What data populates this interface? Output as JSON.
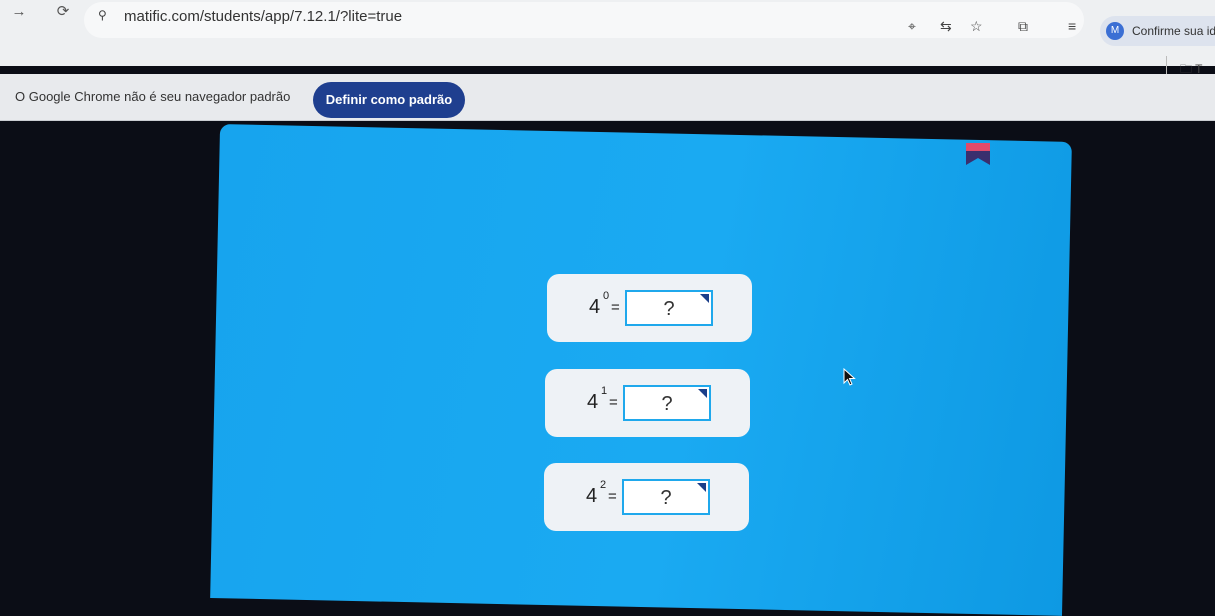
{
  "browser": {
    "url": "matific.com/students/app/7.12.1/?lite=true",
    "profile_label": "Confirme sua id",
    "profile_initial": "M",
    "bookmark_label": "T",
    "icons": [
      "back-icon",
      "reload-icon",
      "site-settings-icon",
      "location-icon",
      "translate-icon",
      "bookmark-star-icon",
      "extensions-icon",
      "reading-list-icon",
      "profile-icon",
      "folder-icon"
    ]
  },
  "infobar": {
    "message": "O Google Chrome não é seu navegador padrão",
    "button_label": "Definir como padrão"
  },
  "exercise": {
    "equations": [
      {
        "base": "4",
        "exponent": "0",
        "equals": "=",
        "answer": "?"
      },
      {
        "base": "4",
        "exponent": "1",
        "equals": "=",
        "answer": "?"
      },
      {
        "base": "4",
        "exponent": "2",
        "equals": "=",
        "answer": "?"
      }
    ]
  },
  "colors": {
    "panel": "#17a4ee",
    "button": "#1f3f8f",
    "card": "#eef2f6"
  }
}
